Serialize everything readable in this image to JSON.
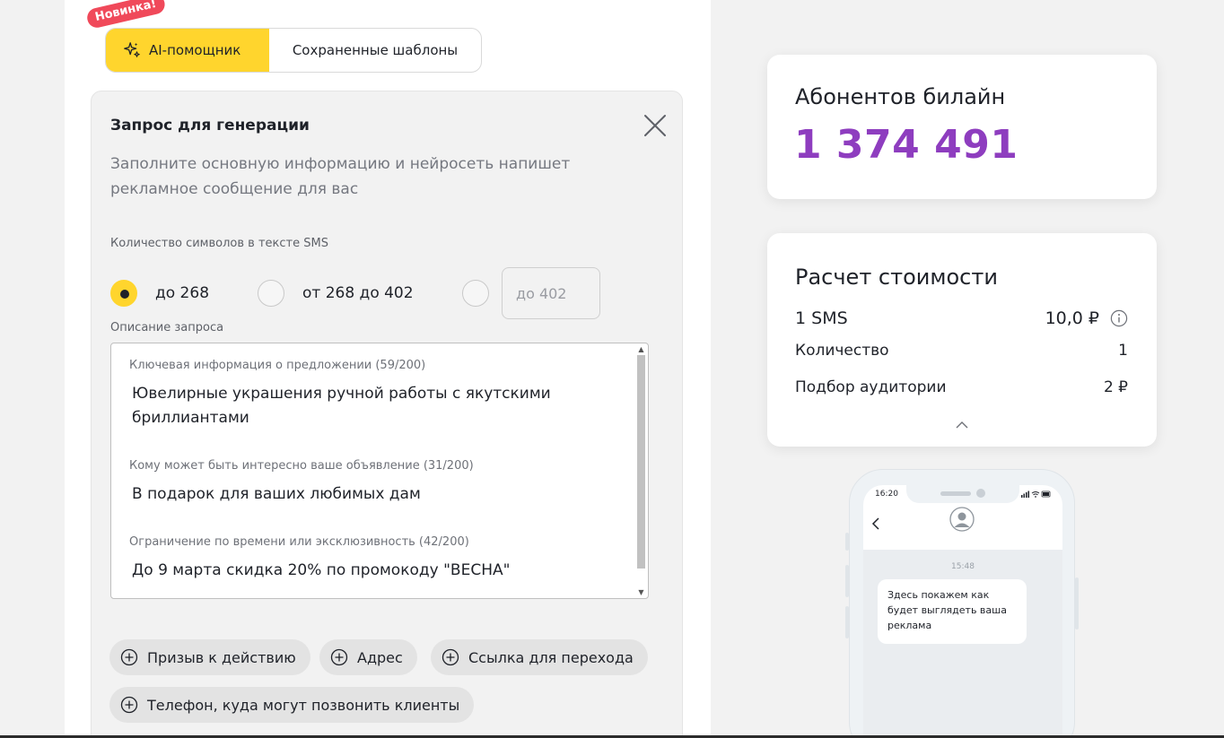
{
  "tabs": {
    "badge": "Новинка!",
    "ai_label": "AI-помощник",
    "saved_label": "Сохраненные шаблоны"
  },
  "generation": {
    "title": "Запрос для генерации",
    "description": "Заполните основную информацию и нейросеть напишет рекламное сообщение для вас",
    "sms_length_label": "Количество символов в тексте SMS",
    "options": [
      {
        "label": "до 268",
        "selected": true
      },
      {
        "label": "от 268 до 402",
        "selected": false
      }
    ],
    "custom_placeholder": "до 402",
    "request_label": "Описание запроса",
    "fields": [
      {
        "label": "Ключевая информация о предложении (59/200)",
        "value": "Ювелирные украшения ручной работы с якутскими бриллиантами"
      },
      {
        "label": "Кому может быть интересно ваше объявление (31/200)",
        "value": "В подарок для ваших любимых дам"
      },
      {
        "label": "Ограничение по времени или эксклюзивность (42/200)",
        "value": "До 9 марта скидка 20% по промокоду \"ВЕСНА\""
      }
    ],
    "chips": [
      "Призыв к действию",
      "Адрес",
      "Ссылка для перехода",
      "Телефон, куда могут позвонить клиенты"
    ]
  },
  "subscribers": {
    "title": "Абонентов билайн",
    "count": "1 374 491"
  },
  "cost": {
    "title": "Расчет стоимости",
    "sms_label": "1 SMS",
    "sms_price": "10,0 ₽",
    "qty_label": "Количество",
    "qty_value": "1",
    "audience_label": "Подбор аудитории",
    "audience_value": "2 ₽"
  },
  "phone": {
    "status_time": "16:20",
    "message_time": "15:48",
    "message": "Здесь покажем как будет выглядеть ваша реклама"
  },
  "colors": {
    "accent": "#ffd52d",
    "badge": "#f0495a",
    "count": "#8e3dbf"
  }
}
